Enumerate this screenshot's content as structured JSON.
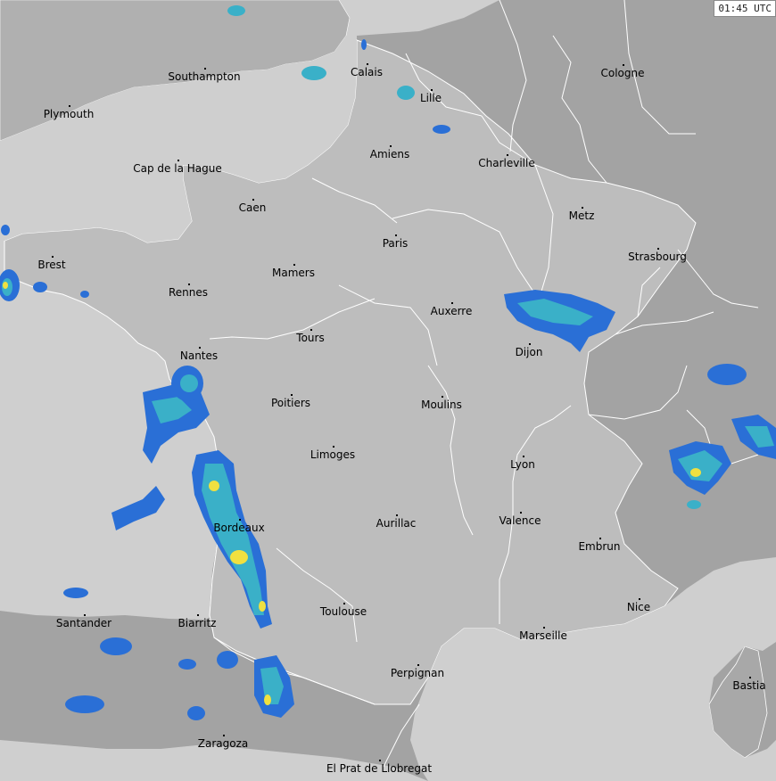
{
  "timestamp": "01:45 UTC",
  "colors": {
    "sea": "#cfcfcf",
    "land": "#b4b4b4",
    "france": "#bcbcbc",
    "dark_land": "#9e9e9e",
    "border": "#ffffff",
    "precip_light": "#2a6fd6",
    "precip_medium": "#3ab0c8",
    "precip_heavy": "#f0e040"
  },
  "cities": [
    {
      "name": "Southampton"
    },
    {
      "name": "Plymouth"
    },
    {
      "name": "Calais"
    },
    {
      "name": "Lille"
    },
    {
      "name": "Cologne"
    },
    {
      "name": "Cap de la Hague"
    },
    {
      "name": "Amiens"
    },
    {
      "name": "Charleville"
    },
    {
      "name": "Caen"
    },
    {
      "name": "Metz"
    },
    {
      "name": "Paris"
    },
    {
      "name": "Brest"
    },
    {
      "name": "Strasbourg"
    },
    {
      "name": "Mamers"
    },
    {
      "name": "Rennes"
    },
    {
      "name": "Auxerre"
    },
    {
      "name": "Tours"
    },
    {
      "name": "Dijon"
    },
    {
      "name": "Nantes"
    },
    {
      "name": "Poitiers"
    },
    {
      "name": "Moulins"
    },
    {
      "name": "Limoges"
    },
    {
      "name": "Lyon"
    },
    {
      "name": "Aurillac"
    },
    {
      "name": "Valence"
    },
    {
      "name": "Bordeaux"
    },
    {
      "name": "Embrun"
    },
    {
      "name": "Toulouse"
    },
    {
      "name": "Nice"
    },
    {
      "name": "Santander"
    },
    {
      "name": "Biarritz"
    },
    {
      "name": "Marseille"
    },
    {
      "name": "Perpignan"
    },
    {
      "name": "Bastia"
    },
    {
      "name": "Zaragoza"
    },
    {
      "name": "El Prat de Llobregat"
    }
  ]
}
